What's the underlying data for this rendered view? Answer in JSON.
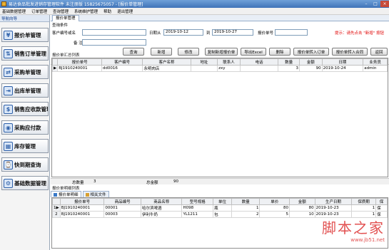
{
  "window": {
    "title": "易达食品批发进销存管理软件 未注册版 15825675057 - [报价单管理]",
    "minimize": "–",
    "maximize": "□",
    "close": "×"
  },
  "menu": [
    "基础数据管理",
    "订单管理",
    "查询管理",
    "系统维护管理",
    "帮助",
    "退出管理"
  ],
  "nav": {
    "header": "导航向导",
    "items": [
      {
        "label": "报价单管理",
        "icon": "quote-icon",
        "glyph": "¥"
      },
      {
        "label": "销售订单管理",
        "icon": "sales-order-icon",
        "glyph": "⇅"
      },
      {
        "label": "采购单管理",
        "icon": "purchase-icon",
        "glyph": "⇄"
      },
      {
        "label": "出库单管理",
        "icon": "outbound-icon",
        "glyph": "⇥"
      },
      {
        "label": "销售应收款管理",
        "icon": "receivable-icon",
        "glyph": "$"
      },
      {
        "label": "采购应付款",
        "icon": "payable-icon",
        "glyph": "◉"
      },
      {
        "label": "库存管理",
        "icon": "inventory-icon",
        "glyph": "▦"
      },
      {
        "label": "快到期查询",
        "icon": "expiry-query-icon",
        "glyph": "⌚"
      },
      {
        "label": "基础数据管理",
        "icon": "basic-data-icon",
        "glyph": "⚙"
      }
    ]
  },
  "doc_tab": "报价单管理",
  "query": {
    "section": "查询条件",
    "customer_label": "客户编号或名",
    "customer_value": "",
    "date_from_label": "日期从",
    "date_from": "2019-10-12",
    "date_to_label": "到",
    "date_to": "2019-10-27",
    "quote_no_label": "报价单号",
    "quote_no_value": "",
    "remark_label": "备 注",
    "remark_value": "",
    "hint": "提示：请先点击 \"新增\" 按钮"
  },
  "buttons": {
    "query": "查询",
    "add": "新增",
    "edit": "修改",
    "copy": "复制新增报价单",
    "export": "导出Excel",
    "delete": "删除",
    "to_order": "报价单转入订单",
    "to_contract": "报价单转入合同",
    "back": "返回"
  },
  "summary": {
    "section": "报价单汇总列表",
    "columns": [
      "报价单号",
      "客户编号",
      "客户名称",
      "地址",
      "联系人",
      "电话",
      "数量",
      "金额",
      "日期",
      "业务员"
    ],
    "rows": [
      [
        "BJ1910240001",
        "dd0016",
        "永明肉店",
        "",
        "zxy",
        "",
        "3",
        "90",
        "2019-10-24",
        "admin"
      ]
    ]
  },
  "totals": {
    "count_label": "总数量",
    "count": "3",
    "amount_label": "总金额",
    "amount": "90"
  },
  "detail": {
    "section": "报价单明细列表",
    "tabs": [
      "报价单明细",
      "相关文件"
    ],
    "columns": [
      "报价单号",
      "商品编号",
      "商品名称",
      "型号规格",
      "单位",
      "数量",
      "单价",
      "金额",
      "生产日期",
      "保质期",
      "保"
    ],
    "rows": [
      [
        "BJ1910240001",
        "00001",
        "哈尔滨啤酒",
        "H098",
        "瓶",
        "1",
        "80",
        "80",
        "2019-10-23",
        "1",
        "保"
      ],
      [
        "BJ1910240001",
        "00003",
        "伊利牛奶",
        "YL1211",
        "包",
        "2",
        "5",
        "10",
        "2019-10-23",
        "1",
        "保"
      ]
    ]
  },
  "watermark": {
    "big": "脚本之家",
    "small": "www.jb51.net"
  }
}
